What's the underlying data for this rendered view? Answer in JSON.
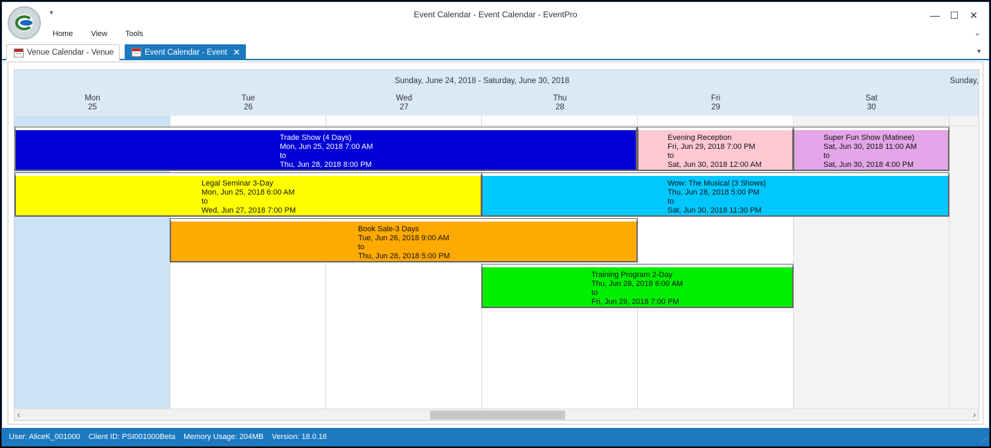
{
  "window": {
    "title": "Event Calendar - Event Calendar - EventPro",
    "controls": {
      "minimize": "—",
      "maximize": "☐",
      "close": "✕"
    }
  },
  "menu": [
    "Home",
    "View",
    "Tools"
  ],
  "tabs": {
    "inactive_label": "Venue Calendar - Venue",
    "active_label": "Event Calendar - Event",
    "close": "✕"
  },
  "calendar": {
    "range": "Sunday, June 24, 2018 - Saturday, June 30, 2018",
    "next_range": "Sunday,",
    "days": [
      {
        "name": "Mon",
        "num": "25"
      },
      {
        "name": "Tue",
        "num": "26"
      },
      {
        "name": "Wed",
        "num": "27"
      },
      {
        "name": "Thu",
        "num": "28"
      },
      {
        "name": "Fri",
        "num": "29"
      },
      {
        "name": "Sat",
        "num": "30"
      }
    ],
    "events": [
      {
        "title": "Trade Show (4 Days)",
        "start": "Mon, Jun 25, 2018 7:00 AM",
        "to": "to",
        "end": "Thu, Jun 28, 2018 8:00 PM",
        "color": "#0000d6"
      },
      {
        "title": "Evening Reception",
        "start": "Fri, Jun 29, 2018 7:00 PM",
        "to": "to",
        "end": "Sat, Jun 30, 2018 12:00 AM",
        "color": "#ffc8d2"
      },
      {
        "title": "Super Fun Show (Matinee)",
        "start": "Sat, Jun 30, 2018 11:00 AM",
        "to": "to",
        "end": "Sat, Jun 30, 2018 4:00 PM",
        "color": "#e4a6e8"
      },
      {
        "title": "Legal Seminar 3-Day",
        "start": "Mon, Jun 25, 2018 6:00 AM",
        "to": "to",
        "end": "Wed, Jun 27, 2018 7:00 PM",
        "color": "#ffff00"
      },
      {
        "title": "Wow: The Musical (3 Shows)",
        "start": "Thu, Jun 28, 2018 5:00 PM",
        "to": "to",
        "end": "Sat, Jun 30, 2018 11:30 PM",
        "color": "#00c8ff"
      },
      {
        "title": "Book Sale-3 Days",
        "start": "Tue, Jun 26, 2018 9:00 AM",
        "to": "to",
        "end": "Thu, Jun 28, 2018 5:00 PM",
        "color": "#ffaa00"
      },
      {
        "title": "Training Program 2-Day",
        "start": "Thu, Jun 28, 2018 6:00 AM",
        "to": "to",
        "end": "Fri, Jun 29, 2018 7:00 PM",
        "color": "#00ee00"
      }
    ]
  },
  "status": {
    "user": "User: AliceK_001000",
    "client": "Client ID: PSI001000Beta",
    "memory": "Memory Usage: 204MB",
    "version": "Version: 18.0.16"
  }
}
